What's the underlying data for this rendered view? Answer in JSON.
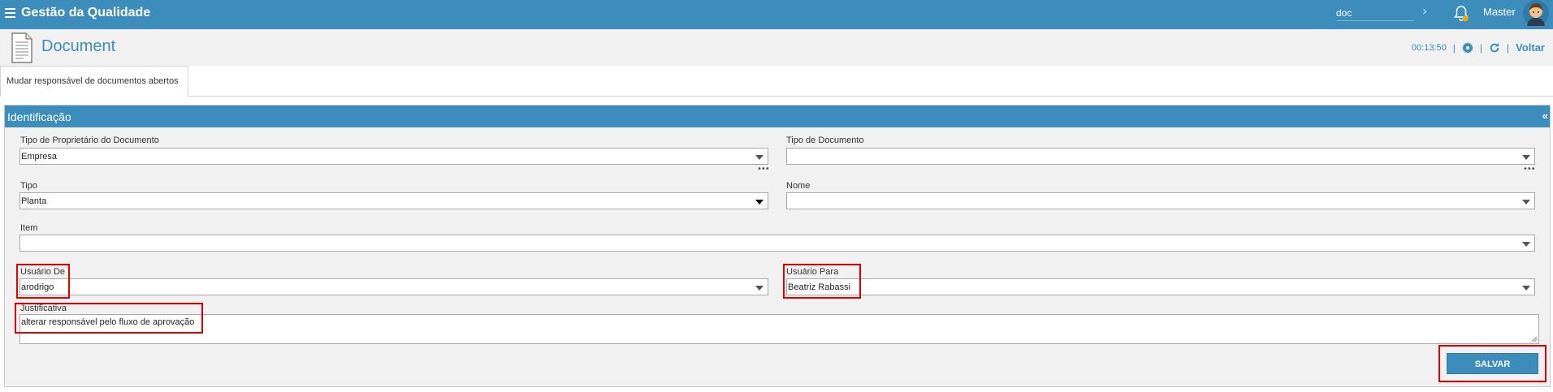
{
  "header": {
    "app_title": "Gestão da Qualidade",
    "search_value": "doc",
    "user_name": "Master"
  },
  "page": {
    "title": "Document",
    "timer": "00:13:50",
    "back_label": "Voltar"
  },
  "tabs": [
    {
      "label": "Mudar responsável de documentos abertos",
      "active": true
    }
  ],
  "panel": {
    "title": "Identificação",
    "collapse_symbol": "«"
  },
  "form": {
    "owner_type": {
      "label": "Tipo de Proprietário do Documento",
      "value": "Empresa"
    },
    "doc_type": {
      "label": "Tipo de Documento",
      "value": ""
    },
    "tipo": {
      "label": "Tipo",
      "value": "Planta"
    },
    "nome": {
      "label": "Nome",
      "value": ""
    },
    "item": {
      "label": "Item",
      "value": ""
    },
    "user_from": {
      "label": "Usuário De",
      "value": "arodrigo"
    },
    "user_to": {
      "label": "Usuário Para",
      "value": "Beatriz Rabassi"
    },
    "justification": {
      "label": "Justificativa",
      "value": "alterar responsável pelo fluxo de aprovação"
    },
    "save_label": "SALVAR"
  },
  "colors": {
    "primary": "#3c8dbc",
    "highlight": "#e00000",
    "background": "#f1f1f1"
  }
}
